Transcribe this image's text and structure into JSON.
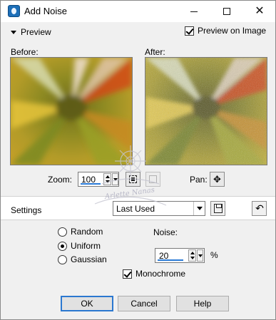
{
  "window": {
    "title": "Add Noise",
    "controls": {
      "minimize": "minimize-icon",
      "maximize": "maximize-icon",
      "close": "close-icon"
    }
  },
  "preview": {
    "toggle_label": "Preview",
    "preview_on_image_label": "Preview on Image",
    "preview_on_image_checked": true,
    "before_label": "Before:",
    "after_label": "After:"
  },
  "zoom": {
    "label": "Zoom:",
    "value": "100",
    "pan_label": "Pan:"
  },
  "settings": {
    "label": "Settings",
    "preset_value": "Last Used"
  },
  "noise_type": {
    "options": [
      "Random",
      "Uniform",
      "Gaussian"
    ],
    "selected": "Uniform"
  },
  "noise": {
    "label": "Noise:",
    "value": "20",
    "unit": "%"
  },
  "monochrome": {
    "label": "Monochrome",
    "checked": true
  },
  "buttons": {
    "ok": "OK",
    "cancel": "Cancel",
    "help": "Help"
  },
  "watermark_text": "Arlette Nanas",
  "colors": {
    "accent": "#2b78d0",
    "window_bg": "#f0f0f0",
    "title_bg": "#ffffff"
  }
}
